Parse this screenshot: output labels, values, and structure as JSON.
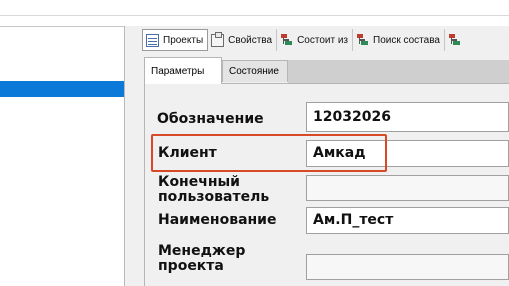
{
  "toolbar": {
    "tabs": [
      {
        "label": "Проекты",
        "icon": "grid-icon",
        "active": true
      },
      {
        "label": "Свойства",
        "icon": "properties-icon",
        "active": false
      },
      {
        "label": "Состоит из",
        "icon": "tree-icon",
        "active": false
      },
      {
        "label": "Поиск состава",
        "icon": "tree-icon",
        "active": false
      }
    ]
  },
  "subtabs": {
    "params": "Параметры",
    "state": "Состояние"
  },
  "form": {
    "designation": {
      "label": "Обозначение",
      "value": "12032026"
    },
    "client": {
      "label": "Клиент",
      "value": "Амкад"
    },
    "end_user": {
      "label_line1": "Конечный",
      "label_line2": "пользователь",
      "value": ""
    },
    "name": {
      "label": "Наименование",
      "value": "Ам.П_тест"
    },
    "manager": {
      "label_line1": "Менеджер",
      "label_line2": "проекта",
      "value": ""
    }
  },
  "colors": {
    "selection": "#0a79d8",
    "highlight": "#d84a27"
  }
}
